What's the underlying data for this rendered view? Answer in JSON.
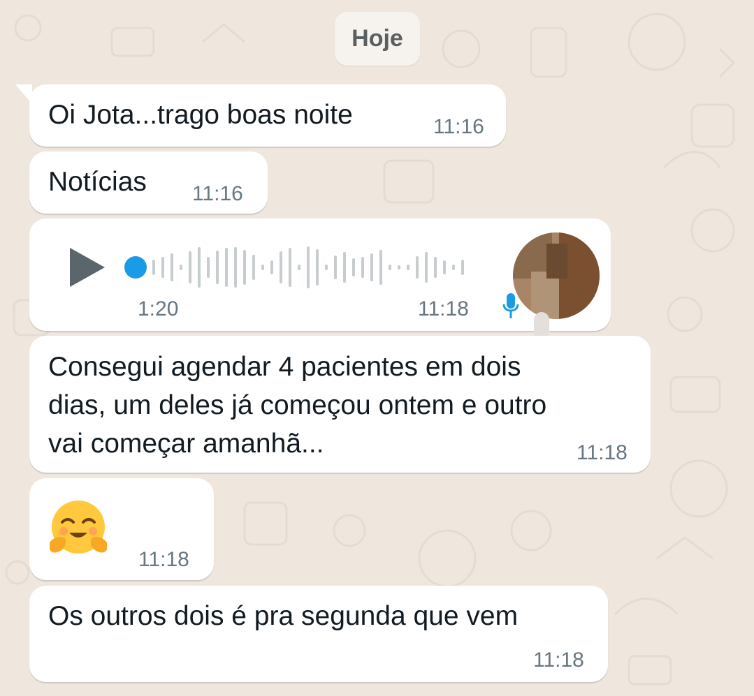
{
  "date_separator": "Hoje",
  "messages": [
    {
      "text": "Oi Jota...trago boas noite",
      "time": "11:16"
    },
    {
      "text": "Notícias",
      "time": "11:16"
    },
    {
      "type": "voice",
      "duration": "1:20",
      "time": "11:18",
      "played": 0.0,
      "icon": "play-icon",
      "status_icon": "mic-icon"
    },
    {
      "text": "Consegui agendar 4 pacientes em dois\ndias, um deles já começou ontem e outro\nvai começar amanhã...",
      "time": "11:18"
    },
    {
      "type": "emoji",
      "icon": "hugging-face-emoji",
      "time": "11:18"
    },
    {
      "text": "Os outros dois é pra segunda que vem",
      "time": "11:18"
    }
  ],
  "colors": {
    "background": "#efe7de",
    "bubble": "#ffffff",
    "text": "#111b21",
    "time": "#667781",
    "voice_dot": "#1a9be6",
    "play": "#5b656c"
  }
}
